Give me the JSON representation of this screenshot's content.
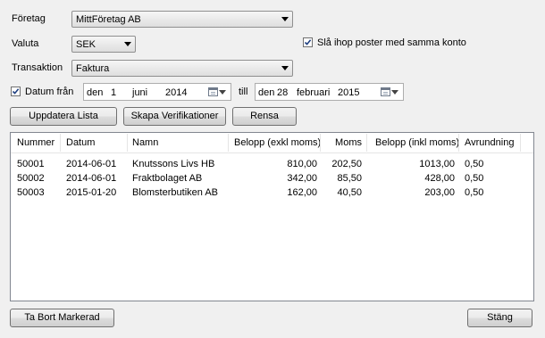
{
  "form": {
    "company_label": "Företag",
    "company_value": "MittFöretag AB",
    "currency_label": "Valuta",
    "currency_value": "SEK",
    "merge_label": "Slå ihop poster med samma konto",
    "merge_checked": true,
    "transaction_label": "Transaktion",
    "transaction_value": "Faktura"
  },
  "date_filter": {
    "label": "Datum från",
    "checked": true,
    "from": {
      "day_prefix": "den",
      "day": "1",
      "month": "juni",
      "year": "2014"
    },
    "till_label": "till",
    "to": {
      "day_prefix": "den",
      "day": "28",
      "month": "februari",
      "year": "2015"
    }
  },
  "toolbar": {
    "update_label": "Uppdatera Lista",
    "create_label": "Skapa Verifikationer",
    "clear_label": "Rensa"
  },
  "table": {
    "columns": [
      "Nummer",
      "Datum",
      "Namn",
      "Belopp (exkl moms)",
      "Moms",
      "Belopp (inkl moms)",
      "Avrundning"
    ],
    "rows": [
      [
        "50001",
        "2014-06-01",
        "Knutssons Livs HB",
        "810,00",
        "202,50",
        "1013,00",
        "0,50"
      ],
      [
        "50002",
        "2014-06-01",
        "Fraktbolaget AB",
        "342,00",
        "85,50",
        "428,00",
        "0,50"
      ],
      [
        "50003",
        "2015-01-20",
        "Blomsterbutiken AB",
        "162,00",
        "40,50",
        "203,00",
        "0,50"
      ]
    ]
  },
  "footer": {
    "delete_label": "Ta Bort Markerad",
    "close_label": "Stäng"
  }
}
